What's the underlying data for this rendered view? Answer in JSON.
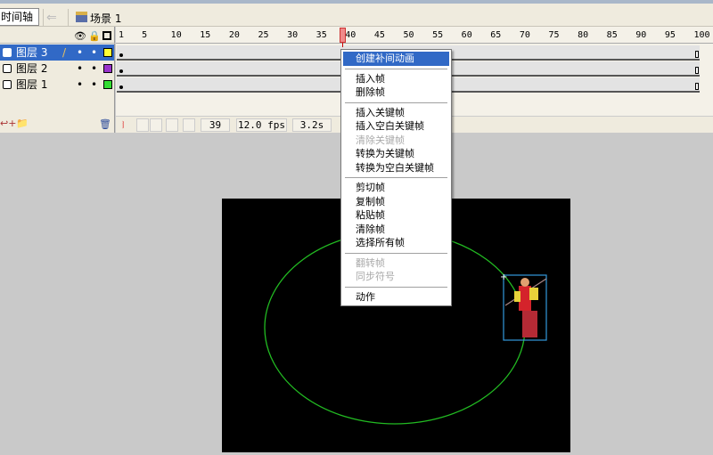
{
  "toolbar": {
    "timeline_button": "时间轴",
    "back_icon": "arrow-left-icon",
    "scene_label": "场景 1"
  },
  "layers": [
    {
      "name": "图层 3",
      "selected": true,
      "color": "#ffff33",
      "edit_icon": "pencil-icon"
    },
    {
      "name": "图层 2",
      "selected": false,
      "color": "#9933cc"
    },
    {
      "name": "图层 1",
      "selected": false,
      "color": "#33dd33"
    }
  ],
  "ruler": {
    "ticks": [
      "1",
      "5",
      "10",
      "15",
      "20",
      "25",
      "30",
      "35",
      "40",
      "45",
      "50",
      "55",
      "60",
      "65",
      "70",
      "75",
      "80",
      "85",
      "90",
      "95",
      "100"
    ]
  },
  "playhead_frame": 39,
  "status": {
    "current_frame": "39",
    "frame_rate": "12.0 fps",
    "elapsed": "3.2s"
  },
  "context_menu": {
    "groups": [
      [
        {
          "label": "创建补间动画",
          "highlighted": true
        }
      ],
      [
        {
          "label": "插入帧"
        },
        {
          "label": "删除帧"
        }
      ],
      [
        {
          "label": "插入关键帧"
        },
        {
          "label": "插入空白关键帧"
        },
        {
          "label": "清除关键帧",
          "disabled": true
        },
        {
          "label": "转换为关键帧"
        },
        {
          "label": "转换为空白关键帧"
        }
      ],
      [
        {
          "label": "剪切帧"
        },
        {
          "label": "复制帧"
        },
        {
          "label": "粘贴帧"
        },
        {
          "label": "清除帧"
        },
        {
          "label": "选择所有帧"
        }
      ],
      [
        {
          "label": "翻转帧",
          "disabled": true
        },
        {
          "label": "同步符号",
          "disabled": true
        }
      ],
      [
        {
          "label": "动作"
        }
      ]
    ]
  },
  "stage": {
    "background": "#000000",
    "path_color": "#22bb22",
    "selection_color": "#3399dd"
  }
}
